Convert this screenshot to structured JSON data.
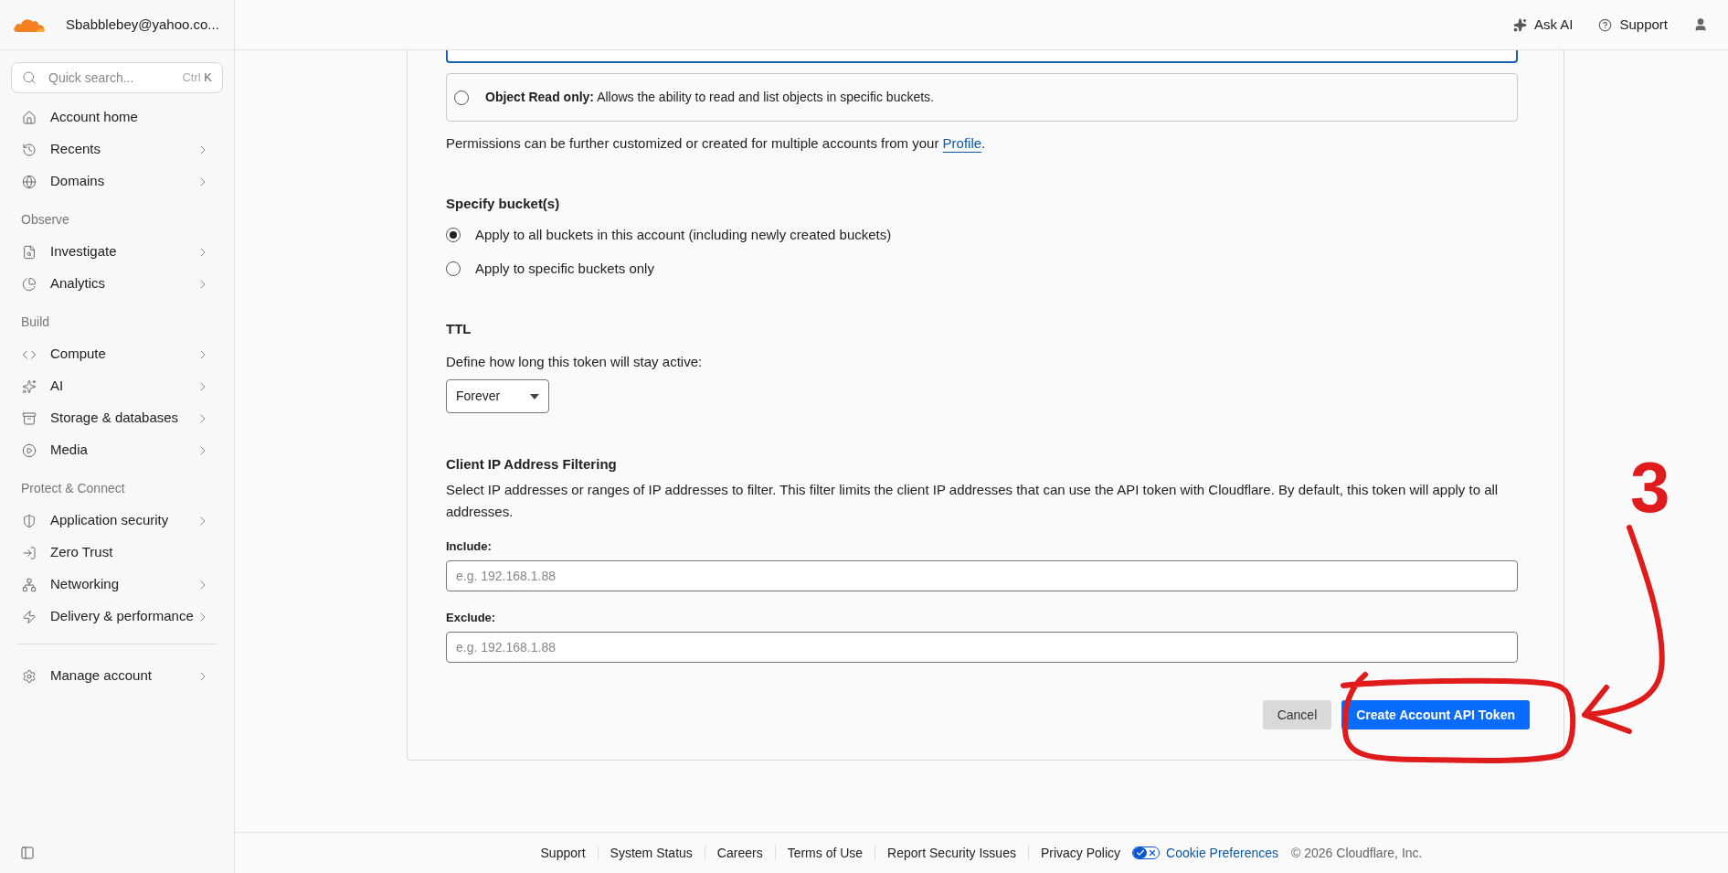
{
  "sidebar": {
    "account": "Sbabblebey@yahoo.co...",
    "search": {
      "placeholder": "Quick search...",
      "shortcut_modifier": "Ctrl",
      "shortcut_key": "K"
    },
    "sections": [
      {
        "items": [
          {
            "label": "Account home",
            "chevron": false
          },
          {
            "label": "Recents",
            "chevron": true
          },
          {
            "label": "Domains",
            "chevron": true
          }
        ]
      },
      {
        "heading": "Observe",
        "items": [
          {
            "label": "Investigate",
            "chevron": true
          },
          {
            "label": "Analytics",
            "chevron": true
          }
        ]
      },
      {
        "heading": "Build",
        "items": [
          {
            "label": "Compute",
            "chevron": true
          },
          {
            "label": "AI",
            "chevron": true
          },
          {
            "label": "Storage & databases",
            "chevron": true
          },
          {
            "label": "Media",
            "chevron": true
          }
        ]
      },
      {
        "heading": "Protect & Connect",
        "items": [
          {
            "label": "Application security",
            "chevron": true
          },
          {
            "label": "Zero Trust",
            "chevron": false
          },
          {
            "label": "Networking",
            "chevron": true
          },
          {
            "label": "Delivery & performance",
            "chevron": true
          }
        ]
      }
    ],
    "bottom_item": {
      "label": "Manage account",
      "chevron": true
    }
  },
  "header": {
    "actions": [
      {
        "label": "Ask AI"
      },
      {
        "label": "Support"
      }
    ]
  },
  "form": {
    "permission_options": [
      {
        "selected": true
      },
      {
        "title": "Object Read only:",
        "description": "Allows the ability to read and list objects in specific buckets.",
        "selected": false
      }
    ],
    "permissions_note": {
      "text": "Permissions can be further customized or created for multiple accounts from your ",
      "link": "Profile",
      "end": "."
    },
    "buckets": {
      "heading": "Specify bucket(s)",
      "options": [
        {
          "label": "Apply to all buckets in this account (including newly created buckets)",
          "selected": true
        },
        {
          "label": "Apply to specific buckets only",
          "selected": false
        }
      ]
    },
    "ttl": {
      "heading": "TTL",
      "description": "Define how long this token will stay active:",
      "value": "Forever"
    },
    "ip_filtering": {
      "heading": "Client IP Address Filtering",
      "description": "Select IP addresses or ranges of IP addresses to filter. This filter limits the client IP addresses that can use the API token with Cloudflare. By default, this token will apply to all addresses.",
      "fields": [
        {
          "label": "Include:",
          "placeholder": "e.g. 192.168.1.88"
        },
        {
          "label": "Exclude:",
          "placeholder": "e.g. 192.168.1.88"
        }
      ]
    },
    "buttons": [
      {
        "label": "Cancel",
        "kind": "secondary"
      },
      {
        "label": "Create Account API Token",
        "kind": "primary"
      }
    ]
  },
  "footer": {
    "links": [
      "Support",
      "System Status",
      "Careers",
      "Terms of Use",
      "Report Security Issues",
      "Privacy Policy"
    ],
    "cookie_preferences": {
      "label": "Cookie Preferences"
    },
    "copyright": "© 2026 Cloudflare, Inc."
  },
  "annotation": {
    "label": "3"
  }
}
